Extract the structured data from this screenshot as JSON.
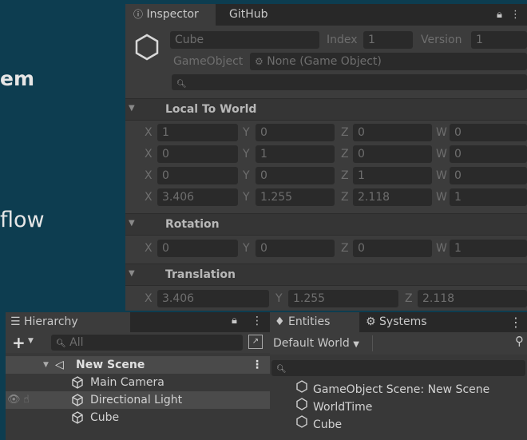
{
  "background": {
    "line1": "em",
    "line2": "flow"
  },
  "inspector": {
    "tab_active": "Inspector",
    "tab_other": "GitHub",
    "entity_name": "Cube",
    "index_label": "Index",
    "index_value": "1",
    "version_label": "Version",
    "version_value": "1",
    "gameobject_label": "GameObject",
    "gameobject_value": "None (Game Object)",
    "sections": {
      "local_to_world": {
        "title": "Local To World",
        "rows": [
          {
            "x": "1",
            "y": "0",
            "z": "0",
            "w": "0"
          },
          {
            "x": "0",
            "y": "1",
            "z": "0",
            "w": "0"
          },
          {
            "x": "0",
            "y": "0",
            "z": "1",
            "w": "0"
          },
          {
            "x": "3.406",
            "y": "1.255",
            "z": "2.118",
            "w": "1"
          }
        ]
      },
      "rotation": {
        "title": "Rotation",
        "x": "0",
        "y": "0",
        "z": "0",
        "w": "1"
      },
      "translation": {
        "title": "Translation",
        "x": "3.406",
        "y": "1.255",
        "z": "2.118"
      }
    },
    "axis": {
      "x": "X",
      "y": "Y",
      "z": "Z",
      "w": "W"
    }
  },
  "hierarchy": {
    "title": "Hierarchy",
    "search_placeholder": "All",
    "scene": "New Scene",
    "items": [
      "Main Camera",
      "Directional Light",
      "Cube"
    ]
  },
  "entities": {
    "tab_active": "Entities",
    "tab_other": "Systems",
    "world": "Default World",
    "items": [
      "GameObject Scene: New Scene",
      "WorldTime",
      "Cube"
    ]
  },
  "colors": {
    "accent": "#0d3d50",
    "panel": "#3c3c3c",
    "field": "#2a2a2a"
  }
}
